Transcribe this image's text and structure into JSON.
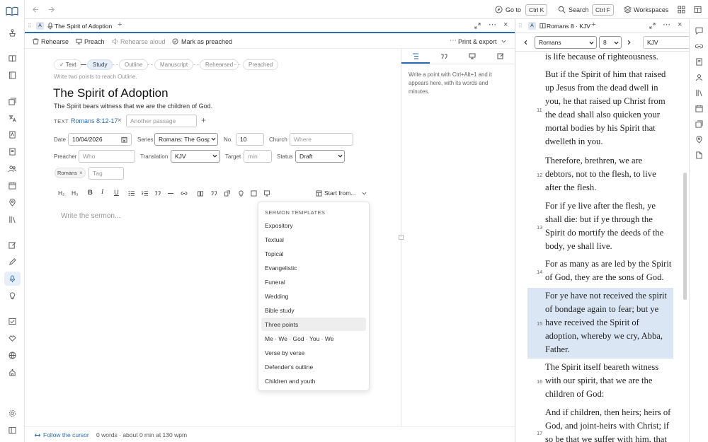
{
  "topbar": {
    "goto_label": "Go to",
    "goto_shortcut": "Ctrl K",
    "search_label": "Search",
    "search_shortcut": "Ctrl F",
    "workspaces_label": "Workspaces"
  },
  "editor_tab": {
    "pane_letter": "A",
    "title": "The Spirit of Adoption"
  },
  "toolbar": {
    "rehearse": "Rehearse",
    "preach": "Preach",
    "rehearse_aloud": "Rehearse aloud",
    "mark_preached": "Mark as preached",
    "print_export": "Print & export"
  },
  "stages": {
    "text": "Text",
    "study": "Study",
    "outline": "Outline",
    "manuscript": "Manuscript",
    "rehearsed": "Rehearsed",
    "preached": "Preached"
  },
  "stage_hint": "Write two points to reach Outline.",
  "sermon": {
    "title": "The Spirit of Adoption",
    "subtitle": "The Spirit bears witness that we are the children of God.",
    "text_label": "TEXT",
    "text_ref": "Romans 8:12-17",
    "another_passage_placeholder": "Another passage"
  },
  "meta": {
    "date_label": "Date",
    "date_value": "10/04/2026",
    "series_label": "Series",
    "series_value": "Romans: The Gosp",
    "no_label": "No.",
    "no_value": "10",
    "church_label": "Church",
    "church_placeholder": "Where",
    "preacher_label": "Preacher",
    "preacher_placeholder": "Who",
    "translation_label": "Translation",
    "translation_value": "KJV",
    "target_label": "Target",
    "target_placeholder": "min",
    "status_label": "Status",
    "status_value": "Draft",
    "tag_chip": "Romans",
    "tag_placeholder": "Tag"
  },
  "format_bar": {
    "h2": "H₂",
    "h3": "H₃",
    "start_from": "Start from..."
  },
  "editor": {
    "placeholder": "Write the sermon..."
  },
  "templates": {
    "header": "SERMON TEMPLATES",
    "items": [
      "Expository",
      "Textual",
      "Topical",
      "Evangelistic",
      "Funeral",
      "Wedding",
      "Bible study",
      "Three points",
      "Me · We · God · You · We",
      "Verse by verse",
      "Defender's outline",
      "Children and youth"
    ],
    "highlighted": "Three points"
  },
  "outline_panel": {
    "hint": "Write a point with Ctrl+Alt+1 and it appears here, with its words and minutes."
  },
  "status_bar": {
    "follow_cursor": "Follow the cursor",
    "word_count": "0 words · about 0 min at 130 wpm"
  },
  "bible_tab": {
    "pane_letter": "A",
    "title": "Romans 8 · KJV",
    "book": "Romans",
    "chapter": "8",
    "version": "KJV"
  },
  "bible": {
    "lead": "is life because of righteousness.",
    "verses": [
      {
        "num": "11",
        "text": "But if the Spirit of him that raised up Jesus from the dead dwell in you, he that raised up Christ from the dead shall also quicken your mortal bodies by his Spirit that dwelleth in you."
      },
      {
        "num": "12",
        "text": "Therefore, brethren, we are debtors, not to the flesh, to live after the flesh."
      },
      {
        "num": "13",
        "text": "For if ye live after the flesh, ye shall die: but if ye through the Spirit do mortify the deeds of the body, ye shall live."
      },
      {
        "num": "14",
        "text": "For as many as are led by the Spirit of God, they are the sons of God."
      },
      {
        "num": "15",
        "text": "For ye have not received the spirit of bondage again to fear; but ye have received the Spirit of adoption, whereby we cry, Abba, Father."
      },
      {
        "num": "16",
        "text": "The Spirit itself beareth witness with our spirit, that we are the children of God:"
      },
      {
        "num": "17",
        "text": "And if children, then heirs; heirs of God, and joint-heirs with Christ; if so be that we suffer with him, that"
      }
    ]
  },
  "colors": {
    "accent": "#2b6cb0",
    "highlight": "#dbe6f4",
    "active_rail": "#e6eef8"
  }
}
